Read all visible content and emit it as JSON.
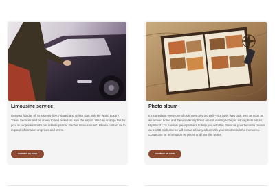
{
  "cards": [
    {
      "title": "Limousine service",
      "text": "Get your holiday off to a stress-free, relaxed and stylish start with My World Luxury Travel Services and be driven to and picked up from the airport. We can arrange this for you, in cooperation with our reliable partner Fischer Limousine AG. Please contact us to request information on prices and terms.",
      "button_label": "contact us now",
      "image_icon": "limousine-door-photo"
    },
    {
      "title": "Photo album",
      "text": "It's something every one of us knows only too well – our busy lives took over as soon as we arrived home and the wonderful photos are still waiting to be put into a photo album. My World LTS has two great partners to help you with this. Send us your favourite photos on a USB stick and we will create a lovely album with your most wonderful memories. Contact us for information on prices and how this works.",
      "button_label": "contact us now",
      "image_icon": "photo-album-photo"
    }
  ],
  "colors": {
    "button_bg": "#8a4b32",
    "card_bg": "#f4f4f4"
  }
}
